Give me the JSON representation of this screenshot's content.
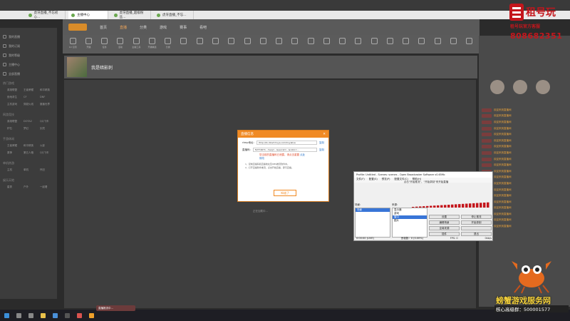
{
  "browser": {
    "tabs": [
      {
        "label": "虎牙直播_不忘初心...",
        "active": false
      },
      {
        "label": "主播中心",
        "active": false
      },
      {
        "label": "虎牙直播_超级粉丝...",
        "active": false
      },
      {
        "label": "虎牙直播_不忘...",
        "active": false
      }
    ],
    "url": "https://i.huya.com/"
  },
  "site": {
    "nav": [
      "首页",
      "直播",
      "分类",
      "游戏",
      "赛事",
      "看吧"
    ],
    "active_nav": "直播",
    "categories": [
      "10 订阅",
      "开播",
      "任务",
      "活动",
      "主播工具",
      "开播精选",
      "分类",
      "",
      "",
      "",
      "",
      "",
      "",
      "",
      "",
      "",
      "",
      "",
      "",
      "",
      "",
      "",
      "",
      "",
      "",
      ""
    ]
  },
  "sidebar": {
    "rows": [
      "我的直播",
      "我的订阅",
      "我的等级",
      "主播中心",
      "全部直播"
    ],
    "sections": [
      {
        "head": "热门游戏",
        "items": [
          "英雄联盟",
          "王者荣耀",
          "和平精英",
          "绝地求生",
          "CF",
          "DNF",
          "主机游戏",
          "穿越火线",
          "魔兽世界"
        ]
      },
      {
        "head": "网游竞技",
        "items": [
          "英雄联盟",
          "DOTA2",
          "QQ飞车",
          "炉石",
          "梦幻",
          "剑灵"
        ]
      },
      {
        "head": "手游休闲",
        "items": [
          "王者荣耀",
          "和平精英",
          "火影",
          "原神",
          "第五人格",
          "QQ飞车"
        ]
      },
      {
        "head": "单机热游",
        "items": [
          "主机",
          "单机",
          "怀旧"
        ]
      },
      {
        "head": "娱乐天地",
        "items": [
          "星秀",
          "户外",
          "一起看"
        ]
      }
    ]
  },
  "room": {
    "title": "我是暗影刺",
    "tags": [
      "开播标签",
      "主播",
      "日常"
    ]
  },
  "dialog": {
    "title": "直播信息",
    "rtmp_label": "rtmp地址:",
    "rtmp_value": "rtmp://tx.direct.huya.com/huyalive",
    "copy_label": "复制",
    "key_label": "直播码:",
    "key_value": "50774671...?seq=...&secret=...&ratio=...",
    "warn": "您当前的直播码已泄露，请点击重置",
    "reset_link": "点此修改",
    "tips": "1、复制直播码和直播地址至OBS推流软件中。\n2、打开直播软件推流，点击开始直播，即可直播。",
    "ok_label": "知道了"
  },
  "footer_text": "正在加载中...",
  "obs": {
    "title": "Profile: Untitled - Scenes: scenes - Open Broadcaster Software v0.659b",
    "menu": [
      "文件(F)",
      "配置(S)",
      "预览(P)",
      "配置文件(C)",
      "帮助(H)"
    ],
    "header": "点击\"开始推流\"、\"开始录制\"来开始直播",
    "scenes_label": "场景:",
    "sources_label": "来源:",
    "scenes": [
      "场景"
    ],
    "sources": [
      "显示器",
      "游戏",
      "窗口",
      "图片"
    ],
    "selected_source": "窗口",
    "buttons": [
      "设置",
      "停止推流",
      "编辑场景",
      "开始录制",
      "全局来源",
      "",
      "插件",
      "退出"
    ],
    "status": [
      "0:00:00 (LIVE)",
      "丢帧数：0 (0.00%)",
      "FPS: 0",
      "0kb/s"
    ]
  },
  "chat": [
    "欢迎来到直播间",
    "欢迎来到直播间",
    "欢迎来到直播间",
    "欢迎来到直播间",
    "欢迎来到直播间",
    "欢迎来到直播间",
    "欢迎来到直播间",
    "欢迎来到直播间",
    "欢迎来到直播间",
    "欢迎来到直播间",
    "欢迎来到直播间",
    "欢迎来到直播间",
    "欢迎来到直播间",
    "欢迎来到直播间",
    "欢迎来到直播间",
    "欢迎来到直播间",
    "欢迎来到直播间",
    "欢迎来到直播间",
    "欢迎来到直播间",
    "欢迎来到直播间"
  ],
  "taskbar": {
    "clock_time": "",
    "popup": "直播推流中..."
  },
  "watermark": {
    "top_title": "租号玩",
    "top_sub": "租号玩官方客服",
    "top_phone": "808682351",
    "bottom_name": "螃蟹游戏服务网",
    "bottom_qq": "核心高级群：500001577"
  },
  "colors": {
    "accent": "#f08a24",
    "watermark_red": "#c4161c"
  }
}
